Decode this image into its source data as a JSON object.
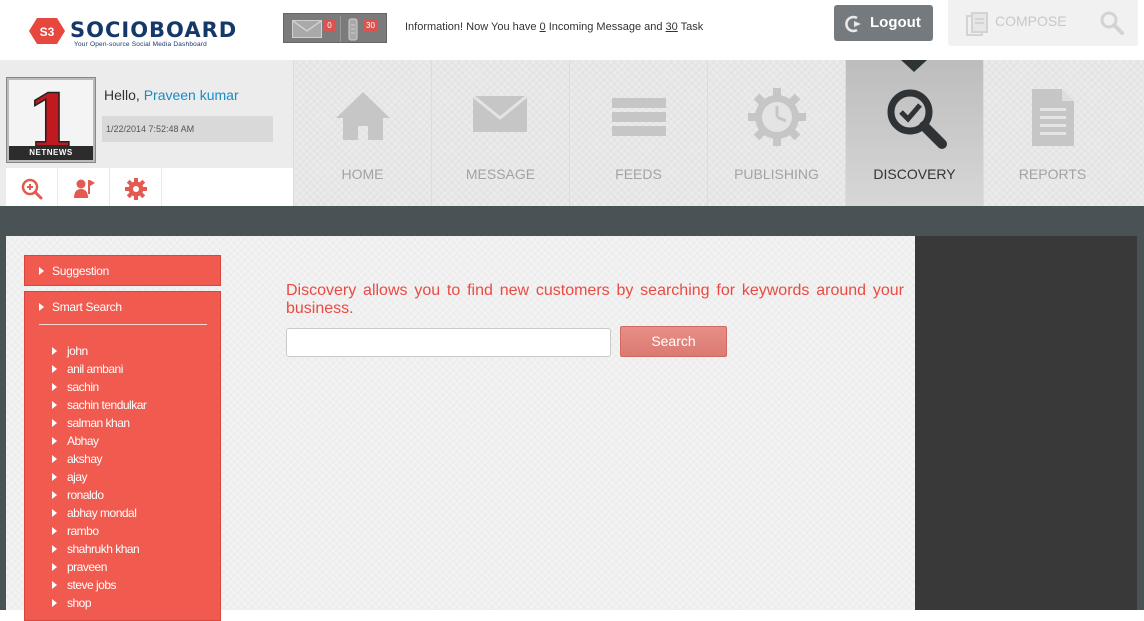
{
  "brand": {
    "badge": "S3",
    "name": "SOCIOBOARD",
    "tagline": "Your Open-source Social Media Dashboard"
  },
  "notifications": {
    "messages_count": "0",
    "tasks_count": "30",
    "info_prefix": "Information! Now You have",
    "info_messages": "0",
    "info_middle": "Incoming Message and",
    "info_tasks": "30",
    "info_suffix": "Task"
  },
  "actions": {
    "logout_label": "Logout",
    "compose_label": "COMPOSE"
  },
  "profile": {
    "greeting": "Hello,",
    "user_name": "Praveen kumar",
    "datetime": "1/22/2014 7:52:48 AM",
    "avatar_text": "NETNEWS",
    "avatar_digit": "1"
  },
  "nav": {
    "items": [
      {
        "label": "HOME",
        "icon": "home-icon"
      },
      {
        "label": "MESSAGE",
        "icon": "envelope-icon"
      },
      {
        "label": "FEEDS",
        "icon": "feeds-icon"
      },
      {
        "label": "PUBLISHING",
        "icon": "clock-gear-icon"
      },
      {
        "label": "DISCOVERY",
        "icon": "search-check-icon"
      },
      {
        "label": "REPORTS",
        "icon": "document-icon"
      }
    ],
    "active": "DISCOVERY"
  },
  "sidebar": {
    "suggestion_label": "Suggestion",
    "smart_search_label": "Smart Search",
    "keywords": [
      "john",
      "anil ambani",
      "sachin",
      "sachin tendulkar",
      "salman khan",
      "Abhay",
      "akshay",
      "ajay",
      "ronaldo",
      "abhay mondal",
      "rambo",
      "shahrukh khan",
      "praveen",
      "steve jobs",
      "shop"
    ]
  },
  "discovery": {
    "description": "Discovery allows you to find new customers by searching for keywords around your business.",
    "search_value": "",
    "search_button_label": "Search"
  },
  "colors": {
    "accent": "#f05a4f",
    "brand_navy": "#15386a",
    "link_blue": "#1a8bc2",
    "dark_strip": "#495255"
  }
}
